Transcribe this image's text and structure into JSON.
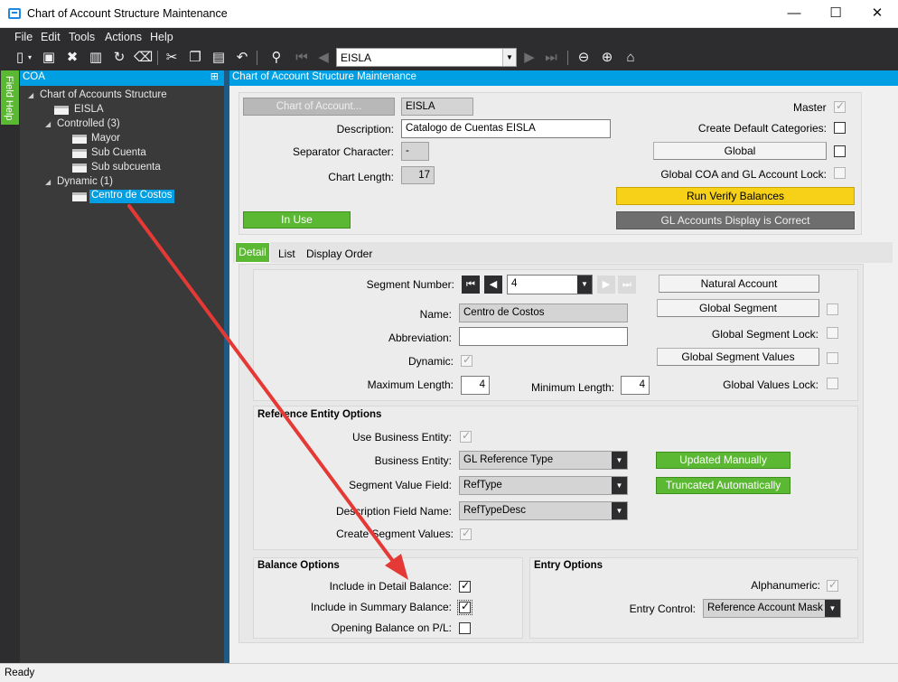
{
  "window": {
    "title": "Chart of Account Structure Maintenance",
    "min": "—",
    "max": "☐",
    "close": "✕"
  },
  "menu": [
    "File",
    "Edit",
    "Tools",
    "Actions",
    "Help"
  ],
  "toolbar": {
    "company": "EISLA"
  },
  "field_help": "Field Help",
  "left": {
    "header": "COA",
    "pin": "⊞",
    "tree": {
      "root": "Chart of Accounts Structure",
      "eisla": "EISLA",
      "controlled": "Controlled (3)",
      "controlled_items": [
        "Mayor",
        "Sub Cuenta",
        "Sub subcuenta"
      ],
      "dynamic": "Dynamic (1)",
      "dynamic_items": [
        "Centro de Costos"
      ]
    }
  },
  "main": {
    "header": "Chart of Account Structure Maintenance",
    "chart_of_account_btn": "Chart of Account...",
    "chart_id": "EISLA",
    "description_label": "Description:",
    "description": "Catalogo de Cuentas EISLA",
    "separator_label": "Separator Character:",
    "separator": "-",
    "chart_length_label": "Chart Length:",
    "chart_length": "17",
    "in_use": "In Use",
    "master_label": "Master",
    "create_default_label": "Create Default Categories:",
    "global_btn": "Global",
    "global_lock_label": "Global COA and GL Account Lock:",
    "run_verify": "Run Verify Balances",
    "gl_display": "GL Accounts Display is Correct",
    "tabs": [
      "Detail",
      "List",
      "Display Order"
    ],
    "segment_number_label": "Segment Number:",
    "segment_number": "4",
    "name_label": "Name:",
    "name": "Centro de Costos",
    "abbreviation_label": "Abbreviation:",
    "abbreviation": "",
    "dynamic_label": "Dynamic:",
    "max_length_label": "Maximum Length:",
    "max_length": "4",
    "min_length_label": "Minimum Length:",
    "min_length": "4",
    "natural_account_btn": "Natural Account",
    "global_segment_btn": "Global Segment",
    "global_segment_lock_label": "Global Segment Lock:",
    "global_segment_values_btn": "Global Segment Values",
    "global_values_lock_label": "Global Values Lock:",
    "ref_group_title": "Reference Entity Options",
    "use_business_entity_label": "Use Business Entity:",
    "business_entity_label": "Business Entity:",
    "business_entity": "GL Reference Type",
    "segment_value_field_label": "Segment Value Field:",
    "segment_value_field": "RefType",
    "description_field_label": "Description Field Name:",
    "description_field": "RefTypeDesc",
    "create_segment_values_label": "Create Segment Values:",
    "updated_manually": "Updated Manually",
    "truncated_automatically": "Truncated Automatically",
    "balance_title": "Balance Options",
    "include_detail_label": "Include in Detail Balance:",
    "include_summary_label": "Include in Summary Balance:",
    "opening_balance_label": "Opening Balance on P/L:",
    "entry_title": "Entry Options",
    "alphanumeric_label": "Alphanumeric:",
    "entry_control_label": "Entry Control:",
    "entry_control": "Reference Account Mask"
  },
  "status": "Ready",
  "colors": {
    "accent": "#009fe3",
    "green": "#5bb832",
    "yellow": "#f7d117",
    "arrow": "#e53935"
  }
}
